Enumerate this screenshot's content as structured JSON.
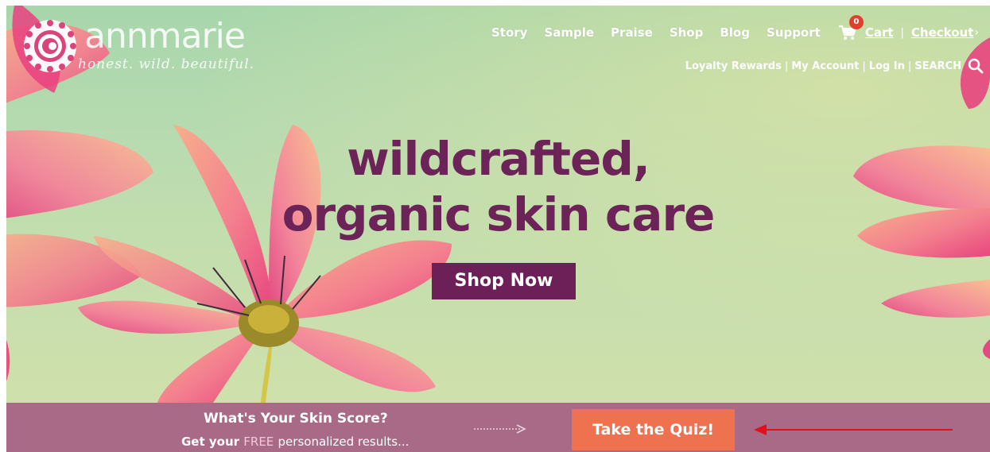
{
  "brand": {
    "name": "annmarie",
    "tagline": "honest. wild. beautiful."
  },
  "nav": {
    "items": [
      "Story",
      "Sample",
      "Praise",
      "Shop",
      "Blog",
      "Support"
    ],
    "cart_count": "0",
    "cart_label": "Cart",
    "separator": "|",
    "checkout_label": "Checkout",
    "checkout_chevron": "›"
  },
  "subnav": {
    "loyalty": "Loyalty Rewards",
    "account": "My Account",
    "login": "Log In",
    "search": "SEARCH",
    "pipe": "|"
  },
  "hero": {
    "headline_line1": "wildcrafted,",
    "headline_line2": "organic skin care",
    "cta_label": "Shop Now"
  },
  "quiz": {
    "title": "What's Your Skin Score?",
    "sub_prefix": "Get your",
    "sub_free": "FREE",
    "sub_rest": "personalized results...",
    "button_label": "Take the Quiz!"
  },
  "colors": {
    "headline": "#6b2358",
    "cta_bg": "#6d2058",
    "band_bg": "#a86a86",
    "quiz_btn_bg": "#ee7150",
    "cart_badge": "#e2402c",
    "annotation_arrow": "#e1111b"
  },
  "icons": {
    "logo": "spiral-flower-logo-icon",
    "cart": "shopping-cart-icon",
    "search": "search-icon",
    "arrow": "dotted-arrow-icon",
    "annotation": "red-arrow-icon"
  }
}
